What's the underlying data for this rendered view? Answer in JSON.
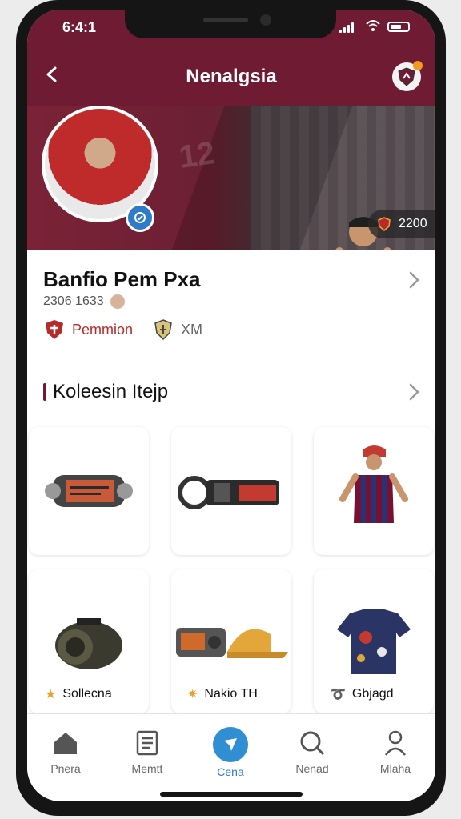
{
  "status_bar": {
    "time": "6:4:1"
  },
  "header": {
    "title": "Nenalgsia"
  },
  "banner": {
    "shirt_text": "12",
    "score_value": "2200"
  },
  "profile": {
    "name": "Banfio Pem Pxa",
    "meta": "2306 1633",
    "tags": [
      {
        "label": "Pemmion"
      },
      {
        "label": "XM"
      }
    ]
  },
  "section": {
    "title": "Koleesin Itejp",
    "items": [
      {
        "name": "scroll-drum"
      },
      {
        "name": "black-belt"
      },
      {
        "name": "player-figure"
      },
      {
        "name": "film-canister"
      },
      {
        "name": "camera-and-cap"
      },
      {
        "name": "jersey"
      }
    ],
    "labels": [
      {
        "icon": "star-icon",
        "text": "Sollecna"
      },
      {
        "icon": "spark-icon",
        "text": "Nakio TH"
      },
      {
        "icon": "ribbon-icon",
        "text": "Gbjagd"
      }
    ]
  },
  "bottom_nav": [
    {
      "label": "Pnera",
      "icon": "home-icon"
    },
    {
      "label": "Memtt",
      "icon": "document-icon"
    },
    {
      "label": "Cena",
      "icon": "compass-icon"
    },
    {
      "label": "Nenad",
      "icon": "search-icon"
    },
    {
      "label": "Mlaha",
      "icon": "user-icon"
    }
  ]
}
